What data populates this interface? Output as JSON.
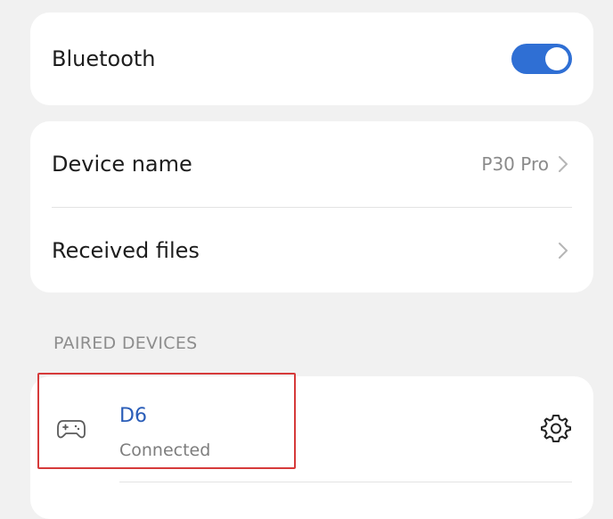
{
  "bluetooth": {
    "label": "Bluetooth",
    "enabled": true
  },
  "device_name": {
    "label": "Device name",
    "value": "P30 Pro"
  },
  "received_files": {
    "label": "Received files"
  },
  "paired_devices": {
    "header": "PAIRED DEVICES",
    "items": [
      {
        "name": "D6",
        "status": "Connected",
        "icon": "gamepad-icon"
      }
    ]
  },
  "colors": {
    "accent": "#2f6fd4",
    "highlight": "#d63a3a",
    "device_name_text": "#2a5db8"
  }
}
